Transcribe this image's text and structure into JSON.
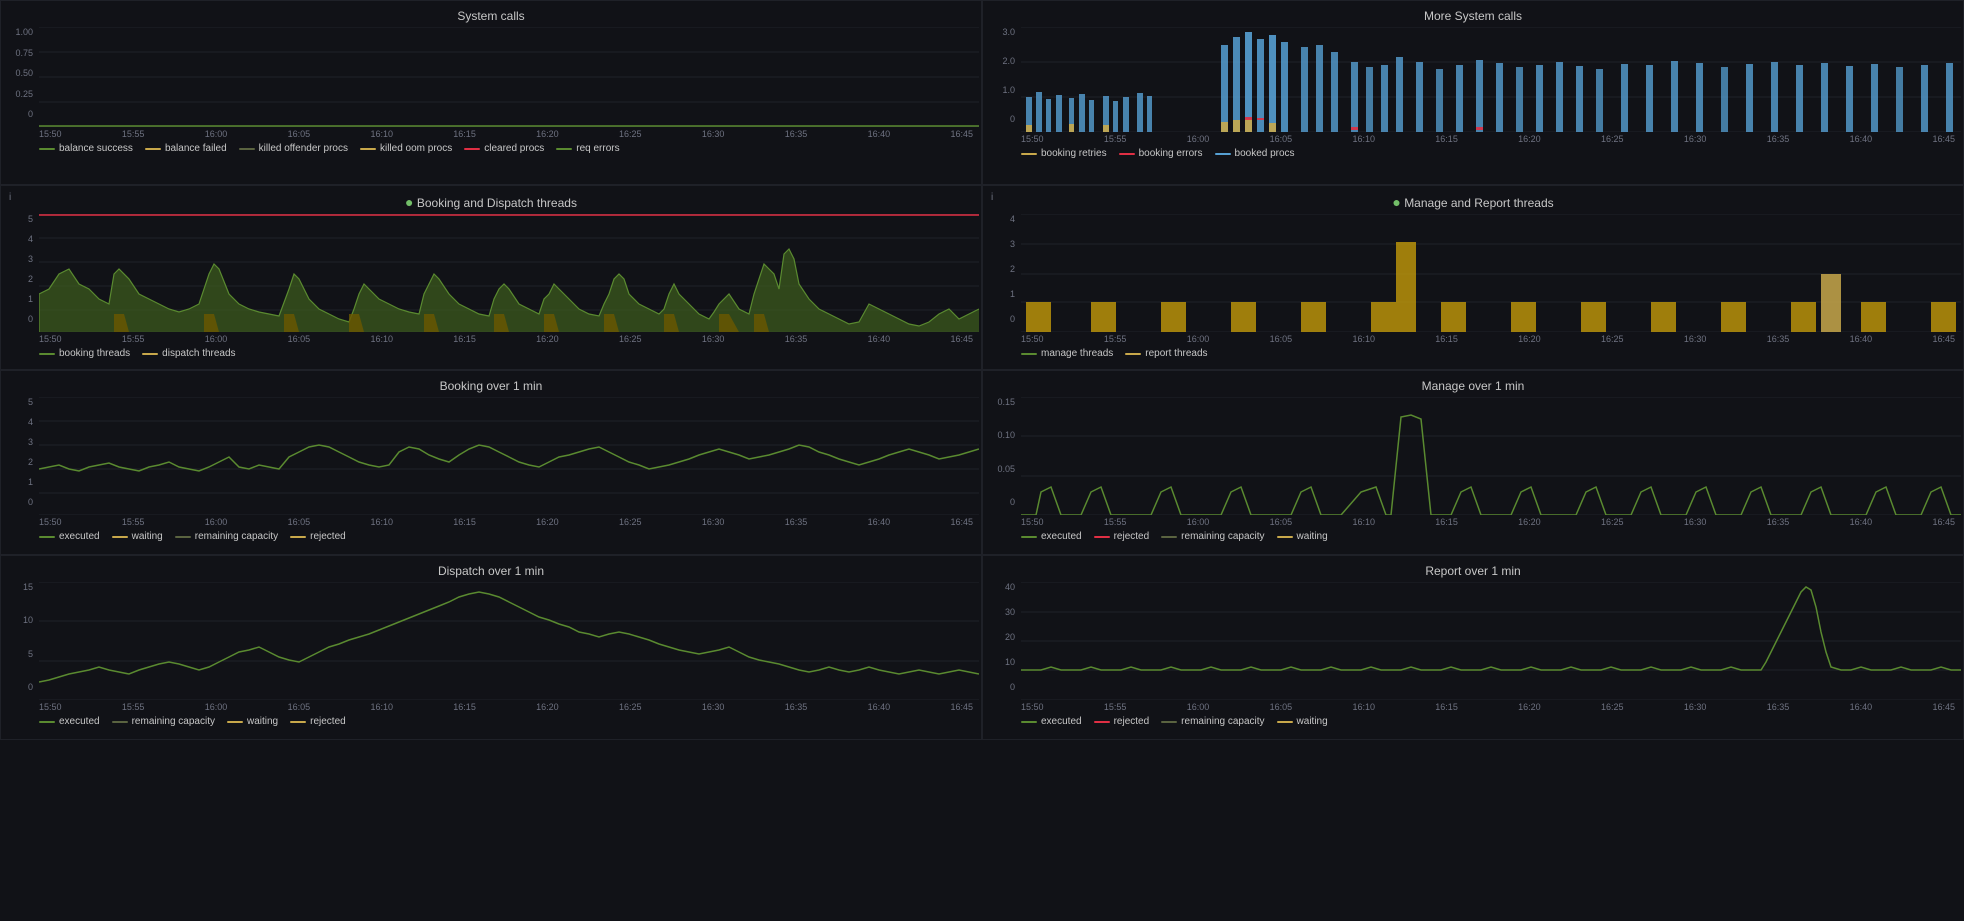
{
  "panels": {
    "system_calls": {
      "title": "System calls",
      "y_labels": [
        "1.00",
        "0.75",
        "0.50",
        "0.25",
        "0"
      ],
      "x_labels": [
        "15:50",
        "15:55",
        "16:00",
        "16:05",
        "16:10",
        "16:15",
        "16:20",
        "16:25",
        "16:30",
        "16:35",
        "16:40",
        "16:45"
      ],
      "legend": [
        {
          "label": "balance success",
          "color": "#5a6340"
        },
        {
          "label": "balance failed",
          "color": "#c8a84b"
        },
        {
          "label": "killed offender procs",
          "color": "#5a6340"
        },
        {
          "label": "killed oom procs",
          "color": "#c8a84b"
        },
        {
          "label": "cleared procs",
          "color": "#e02f44"
        },
        {
          "label": "req errors",
          "color": "#5a6340"
        }
      ]
    },
    "more_system_calls": {
      "title": "More System calls",
      "y_labels": [
        "3.0",
        "2.0",
        "1.0",
        "0"
      ],
      "x_labels": [
        "15:50",
        "15:55",
        "16:00",
        "16:05",
        "16:10",
        "16:15",
        "16:20",
        "16:25",
        "16:30",
        "16:35",
        "16:40",
        "16:45"
      ],
      "legend": [
        {
          "label": "booking retries",
          "color": "#56a0d3"
        },
        {
          "label": "booking errors",
          "color": "#e02f44"
        },
        {
          "label": "booked procs",
          "color": "#c8a84b"
        }
      ]
    },
    "booking_dispatch_threads": {
      "title": "Booking and Dispatch threads",
      "has_dot": true,
      "has_threshold": true,
      "y_labels": [
        "5",
        "4",
        "3",
        "2",
        "1",
        "0"
      ],
      "x_labels": [
        "15:50",
        "15:55",
        "16:00",
        "16:05",
        "16:10",
        "16:15",
        "16:20",
        "16:25",
        "16:30",
        "16:35",
        "16:40",
        "16:45"
      ],
      "legend": [
        {
          "label": "booking threads",
          "color": "#5a8a30"
        },
        {
          "label": "dispatch threads",
          "color": "#c8a84b"
        }
      ]
    },
    "manage_report_threads": {
      "title": "Manage and Report threads",
      "has_dot": true,
      "y_labels": [
        "4",
        "3",
        "2",
        "1",
        "0"
      ],
      "x_labels": [
        "15:50",
        "15:55",
        "16:00",
        "16:05",
        "16:10",
        "16:15",
        "16:20",
        "16:25",
        "16:30",
        "16:35",
        "16:40",
        "16:45"
      ],
      "legend": [
        {
          "label": "manage threads",
          "color": "#5a8a30"
        },
        {
          "label": "report threads",
          "color": "#c8a84b"
        }
      ]
    },
    "booking_over_1min": {
      "title": "Booking over 1 min",
      "y_labels": [
        "5",
        "4",
        "3",
        "2",
        "1",
        "0"
      ],
      "x_labels": [
        "15:50",
        "15:55",
        "16:00",
        "16:05",
        "16:10",
        "16:15",
        "16:20",
        "16:25",
        "16:30",
        "16:35",
        "16:40",
        "16:45"
      ],
      "legend": [
        {
          "label": "executed",
          "color": "#5a8a30"
        },
        {
          "label": "waiting",
          "color": "#c8a84b"
        },
        {
          "label": "remaining capacity",
          "color": "#5a6340"
        },
        {
          "label": "rejected",
          "color": "#c8a84b"
        }
      ]
    },
    "manage_over_1min": {
      "title": "Manage over 1 min",
      "y_labels": [
        "0.15",
        "0.10",
        "0.05",
        "0"
      ],
      "x_labels": [
        "15:50",
        "15:55",
        "16:00",
        "16:05",
        "16:10",
        "16:15",
        "16:20",
        "16:25",
        "16:30",
        "16:35",
        "16:40",
        "16:45"
      ],
      "legend": [
        {
          "label": "executed",
          "color": "#5a8a30"
        },
        {
          "label": "rejected",
          "color": "#e02f44"
        },
        {
          "label": "remaining capacity",
          "color": "#5a6340"
        },
        {
          "label": "waiting",
          "color": "#c8a84b"
        }
      ]
    },
    "dispatch_over_1min": {
      "title": "Dispatch over 1 min",
      "y_labels": [
        "15",
        "10",
        "5",
        "0"
      ],
      "x_labels": [
        "15:50",
        "15:55",
        "16:00",
        "16:05",
        "16:10",
        "16:15",
        "16:20",
        "16:25",
        "16:30",
        "16:35",
        "16:40",
        "16:45"
      ],
      "legend": [
        {
          "label": "executed",
          "color": "#5a8a30"
        },
        {
          "label": "remaining capacity",
          "color": "#5a6340"
        },
        {
          "label": "waiting",
          "color": "#c8a84b"
        },
        {
          "label": "rejected",
          "color": "#c8a84b"
        }
      ]
    },
    "report_over_1min": {
      "title": "Report over 1 min",
      "y_labels": [
        "40",
        "30",
        "20",
        "10",
        "0"
      ],
      "x_labels": [
        "15:50",
        "15:55",
        "16:00",
        "16:05",
        "16:10",
        "16:15",
        "16:20",
        "16:25",
        "16:30",
        "16:35",
        "16:40",
        "16:45"
      ],
      "legend": [
        {
          "label": "executed",
          "color": "#5a8a30"
        },
        {
          "label": "rejected",
          "color": "#e02f44"
        },
        {
          "label": "remaining capacity",
          "color": "#5a6340"
        },
        {
          "label": "waiting",
          "color": "#c8a84b"
        }
      ]
    }
  }
}
